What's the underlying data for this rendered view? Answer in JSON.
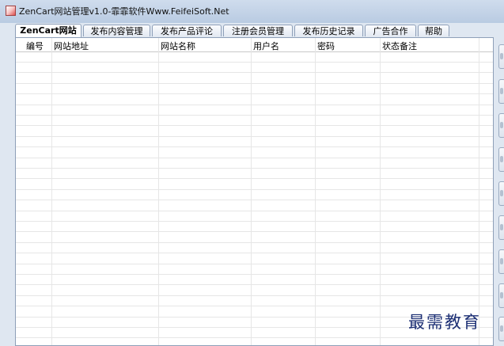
{
  "window": {
    "title": "ZenCart网站管理v1.0-霏霏软件Www.FeifeiSoft.Net"
  },
  "tabs": [
    {
      "label": "ZenCart网站"
    },
    {
      "label": "发布内容管理"
    },
    {
      "label": "发布产品评论"
    },
    {
      "label": "注册会员管理"
    },
    {
      "label": "发布历史记录"
    },
    {
      "label": "广告合作"
    },
    {
      "label": "帮助"
    }
  ],
  "table": {
    "columns": [
      "编号",
      "网站地址",
      "网站名称",
      "用户名",
      "密码",
      "状态备注"
    ],
    "rows": []
  },
  "watermark": "最需教育"
}
